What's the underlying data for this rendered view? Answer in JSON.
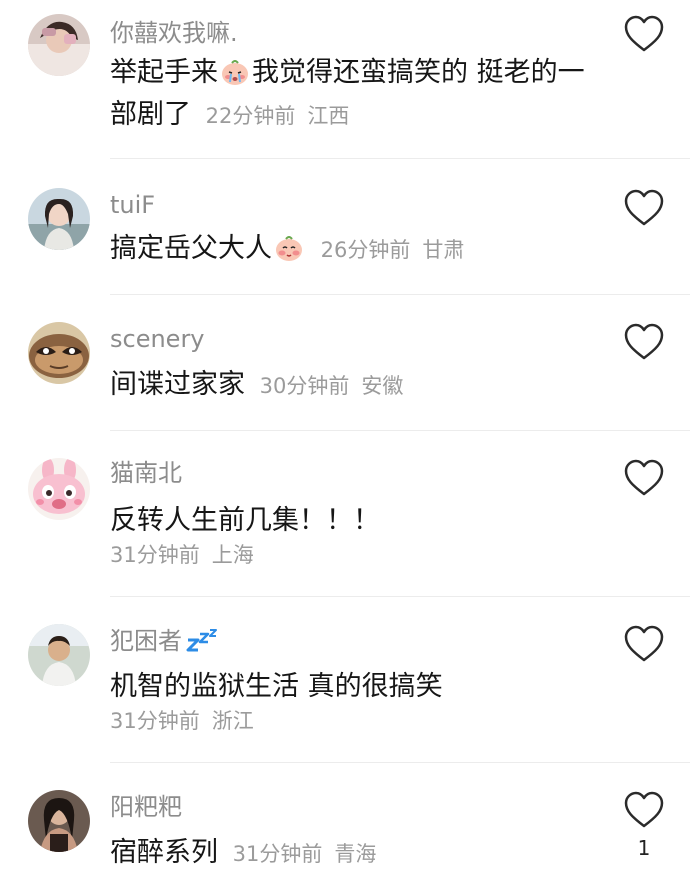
{
  "comments": [
    {
      "username": "你囍欢我嘛.",
      "text_part1": "举起手来",
      "text_part2": "我觉得还蛮搞笑的 挺老的一部剧了",
      "time": "22分钟前",
      "location": "江西",
      "emoji": "crying-peach-emoji"
    },
    {
      "username": "tuiF",
      "text_part1": "搞定岳父大人",
      "time": "26分钟前",
      "location": "甘肃",
      "emoji": "shy-peach-emoji"
    },
    {
      "username": "scenery",
      "text_part1": "间谍过家家",
      "time": "30分钟前",
      "location": "安徽"
    },
    {
      "username": "猫南北",
      "text_part1": "反转人生前几集！！！",
      "time": "31分钟前",
      "location": "上海"
    },
    {
      "username": "犯困者",
      "username_icon": "zzz-sleep-icon",
      "text_part1": "机智的监狱生活 真的很搞笑",
      "time": "31分钟前",
      "location": "浙江"
    },
    {
      "username": "阳粑粑",
      "text_part1": "宿醉系列",
      "time": "31分钟前",
      "location": "青海",
      "like_count": "1"
    }
  ],
  "icons": {
    "like": "heart-outline-icon"
  },
  "colors": {
    "username": "#8c8c8c",
    "body_text": "#161616",
    "meta": "#9b9b9b",
    "divider": "#ececec"
  }
}
